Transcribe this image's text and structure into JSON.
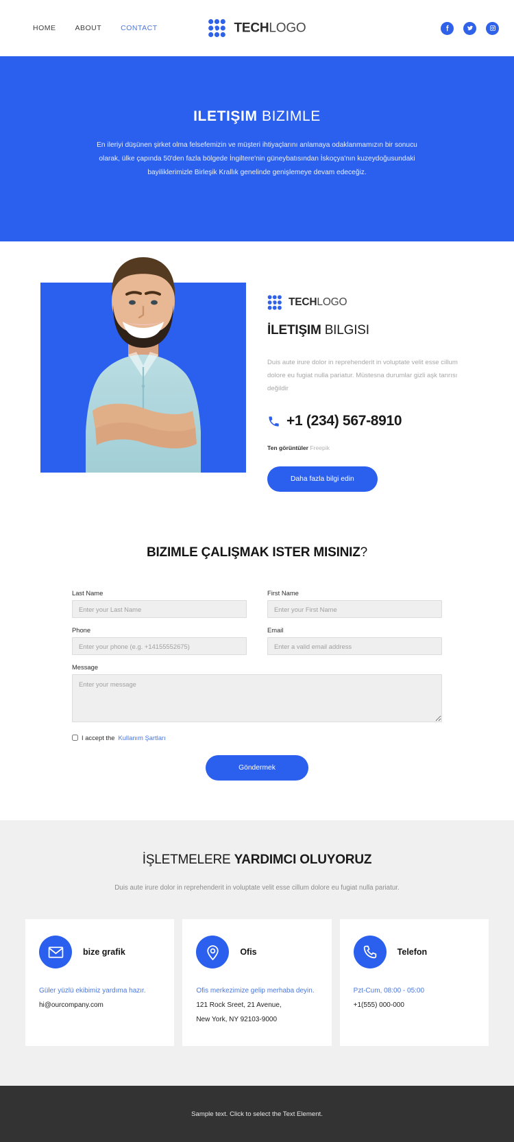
{
  "header": {
    "nav": [
      {
        "label": "HOME",
        "active": false
      },
      {
        "label": "ABOUT",
        "active": false
      },
      {
        "label": "CONTACT",
        "active": true
      }
    ],
    "brand": {
      "bold": "TECH",
      "light": "LOGO"
    },
    "social": [
      {
        "name": "facebook-icon",
        "label": "Facebook"
      },
      {
        "name": "twitter-icon",
        "label": "Twitter"
      },
      {
        "name": "instagram-icon",
        "label": "Instagram"
      }
    ]
  },
  "hero": {
    "title_bold": "ILETIŞIM",
    "title_light": " BIZIMLE",
    "subtitle": "En ileriyi düşünen şirket olma felsefemizin ve müşteri ihtiyaçlarını anlamaya odaklanmamızın bir sonucu olarak, ülke çapında 50'den fazla bölgede İngiltere'nin güneybatısından İskoçya'nın kuzeydoğusundaki bayiliklerimizle Birleşik Krallık genelinde genişlemeye devam edeceğiz."
  },
  "info": {
    "logo_bold": "TECH",
    "logo_light": "LOGO",
    "heading_bold": "İLETIŞIM",
    "heading_light": " BILGISI",
    "paragraph": "Duis aute irure dolor in reprehenderit in voluptate velit esse cillum dolore eu fugiat nulla pariatur. Müstesna durumlar gizli aşk tanrısı değildir",
    "phone": "+1 (234) 567-8910",
    "credit_label": "Ten görüntüler",
    "credit_source": "Freepik",
    "cta_label": "Daha fazla bilgi edin"
  },
  "form": {
    "heading_bold": "BIZIMLE ÇALIŞMAK ISTER MISINIZ",
    "heading_light": "?",
    "fields": {
      "last_name": {
        "label": "Last Name",
        "placeholder": "Enter your Last Name",
        "value": ""
      },
      "first_name": {
        "label": "First Name",
        "placeholder": "Enter your First Name",
        "value": ""
      },
      "phone": {
        "label": "Phone",
        "placeholder": "Enter your phone (e.g. +14155552675)",
        "value": ""
      },
      "email": {
        "label": "Email",
        "placeholder": "Enter a valid email address",
        "value": ""
      },
      "message": {
        "label": "Message",
        "placeholder": "Enter your message",
        "value": ""
      }
    },
    "accept_text": "I accept the",
    "accept_link": "Kullanım Şartları",
    "submit_label": "Göndermek"
  },
  "cards_section": {
    "heading_light": "İŞLETMELERE ",
    "heading_bold": "YARDIMCI OLUYORUZ",
    "subtitle": "Duis aute irure dolor in reprehenderit in voluptate velit esse cillum dolore eu fugiat nulla pariatur.",
    "cards": [
      {
        "icon": "envelope-icon",
        "title": "bize grafik",
        "line_blue": "Güler yüzlü ekibimiz yardıma hazır.",
        "line_dark": "hi@ourcompany.com",
        "line_dark2": ""
      },
      {
        "icon": "map-pin-icon",
        "title": "Ofis",
        "line_blue": "Ofis merkezimize gelip merhaba deyin.",
        "line_dark": "121 Rock Sreet, 21 Avenue,",
        "line_dark2": "New York, NY 92103-9000"
      },
      {
        "icon": "phone-icon",
        "title": "Telefon",
        "line_blue": "Pzt-Cum, 08:00 - 05:00",
        "line_dark": "+1(555) 000-000",
        "line_dark2": ""
      }
    ]
  },
  "footer": {
    "text": "Sample text. Click to select the Text Element."
  },
  "colors": {
    "brand_blue": "#2b5fed",
    "link_blue": "#4a77dd",
    "section_gray": "#f0f0f0",
    "footer_dark": "#333333",
    "input_gray": "#efefef"
  }
}
